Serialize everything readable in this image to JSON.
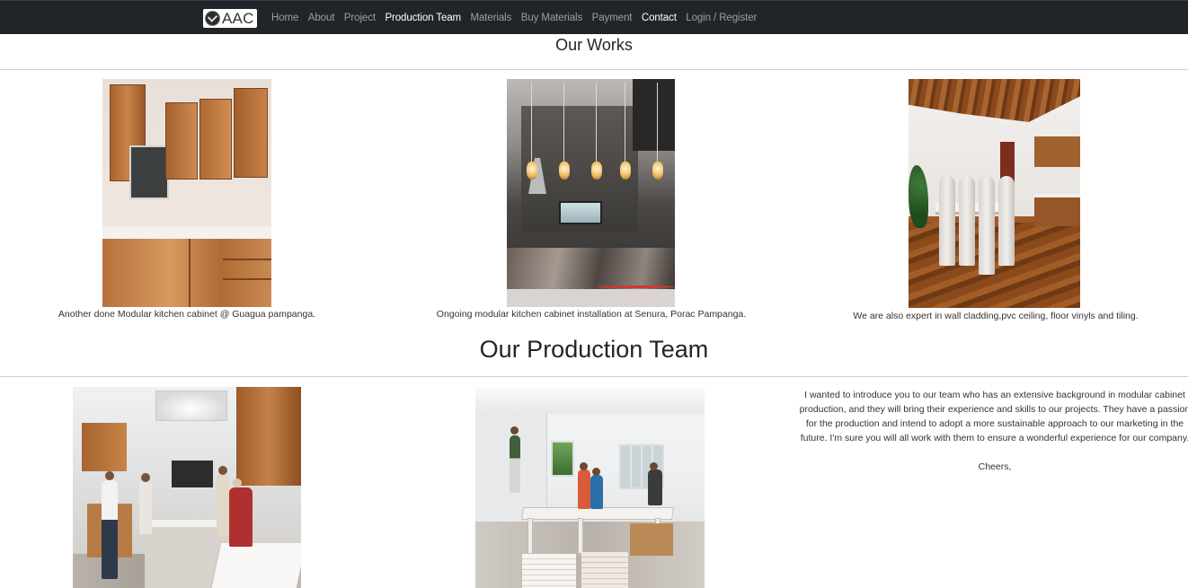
{
  "brand": {
    "logo_text": "AAC"
  },
  "nav": {
    "items": [
      {
        "label": "Home",
        "active": false
      },
      {
        "label": "About",
        "active": false
      },
      {
        "label": "Project",
        "active": false
      },
      {
        "label": "Production Team",
        "active": true
      },
      {
        "label": "Materials",
        "active": false
      },
      {
        "label": "Buy Materials",
        "active": false
      },
      {
        "label": "Payment",
        "active": false
      },
      {
        "label": "Contact",
        "active": true
      },
      {
        "label": "Login / Register",
        "active": false
      }
    ]
  },
  "works": {
    "title": "Our Works",
    "items": [
      {
        "caption": "Another done Modular kitchen cabinet @ Guagua pampanga."
      },
      {
        "caption": "Ongoing modular kitchen cabinet installation at Senura, Porac Pampanga."
      },
      {
        "caption": "We are also expert in wall cladding,pvc ceiling, floor vinyls and tiling."
      }
    ]
  },
  "team": {
    "title": "Our Production Team",
    "intro": "I wanted to introduce you to our team who has an extensive background in modular cabinet production, and they will bring their experience and skills to our projects. They have a passion for the production and intend to adopt a more sustainable approach to our marketing in the future. I'm sure you will all work with them to ensure a wonderful experience for our company.",
    "signoff": "Cheers,"
  },
  "colors": {
    "navbar_bg": "#212529",
    "nav_link": "rgba(255,255,255,0.55)",
    "nav_link_active": "#ffffff",
    "divider": "#cfcfcf"
  }
}
